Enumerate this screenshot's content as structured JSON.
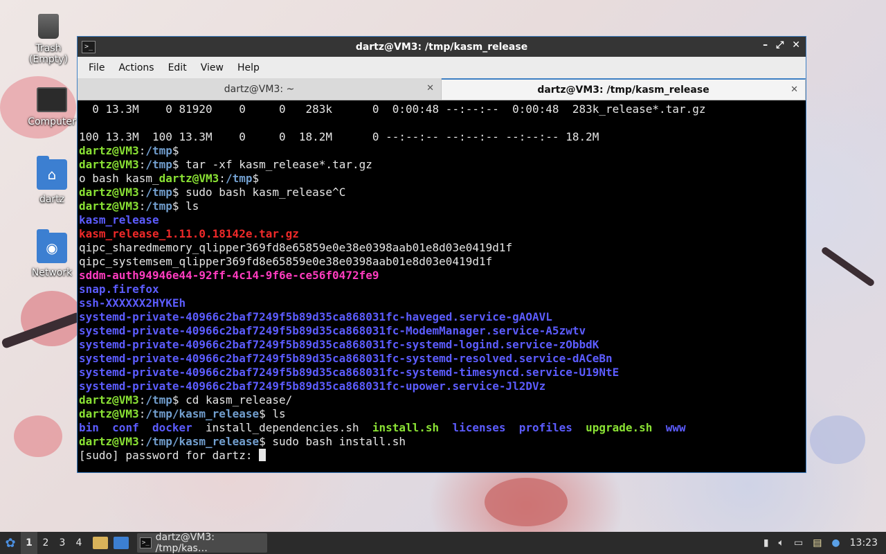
{
  "desktop": {
    "icons": [
      {
        "label": "Trash (Empty)",
        "icon": "trash-icon"
      },
      {
        "label": "Computer",
        "icon": "computer-icon"
      },
      {
        "label": "dartz",
        "icon": "home-folder-icon"
      },
      {
        "label": "Network",
        "icon": "network-icon"
      }
    ]
  },
  "window": {
    "title": "dartz@VM3: /tmp/kasm_release",
    "controls": {
      "minimize": "–",
      "maximize": "⤢",
      "close": "✕"
    },
    "menu": [
      "File",
      "Actions",
      "Edit",
      "View",
      "Help"
    ],
    "tabs": [
      {
        "label": "dartz@VM3: ~",
        "active": false
      },
      {
        "label": "dartz@VM3: /tmp/kasm_release",
        "active": true
      }
    ]
  },
  "terminal": {
    "lines": [
      [
        {
          "t": "  0 13.3M    0 81920    0     0   283k      0  0:00:48 --:--:--  0:00:48  283k_release*.tar.gz",
          "c": ""
        }
      ],
      [
        {
          "t": "",
          "c": ""
        }
      ],
      [
        {
          "t": "100 13.3M  100 13.3M    0     0  18.2M      0 --:--:-- --:--:-- --:--:-- 18.2M",
          "c": ""
        }
      ],
      [
        {
          "t": "dartz@VM3",
          "c": "g"
        },
        {
          "t": ":",
          "c": ""
        },
        {
          "t": "/tmp",
          "c": "b"
        },
        {
          "t": "$",
          "c": ""
        }
      ],
      [
        {
          "t": "dartz@VM3",
          "c": "g"
        },
        {
          "t": ":",
          "c": ""
        },
        {
          "t": "/tmp",
          "c": "b"
        },
        {
          "t": "$ tar -xf kasm_release*.tar.gz",
          "c": ""
        }
      ],
      [
        {
          "t": "o bash kasm_",
          "c": ""
        },
        {
          "t": "dartz@VM3",
          "c": "g"
        },
        {
          "t": ":",
          "c": ""
        },
        {
          "t": "/tmp",
          "c": "b"
        },
        {
          "t": "$",
          "c": ""
        }
      ],
      [
        {
          "t": "dartz@VM3",
          "c": "g"
        },
        {
          "t": ":",
          "c": ""
        },
        {
          "t": "/tmp",
          "c": "b"
        },
        {
          "t": "$ sudo bash kasm_release^C",
          "c": ""
        }
      ],
      [
        {
          "t": "dartz@VM3",
          "c": "g"
        },
        {
          "t": ":",
          "c": ""
        },
        {
          "t": "/tmp",
          "c": "b"
        },
        {
          "t": "$ ls",
          "c": ""
        }
      ],
      [
        {
          "t": "kasm_release",
          "c": "bb"
        }
      ],
      [
        {
          "t": "kasm_release_1.11.0.18142e.tar.gz",
          "c": "r"
        }
      ],
      [
        {
          "t": "qipc_sharedmemory_qlipper369fd8e65859e0e38e0398aab01e8d03e0419d1f",
          "c": ""
        }
      ],
      [
        {
          "t": "qipc_systemsem_qlipper369fd8e65859e0e38e0398aab01e8d03e0419d1f",
          "c": ""
        }
      ],
      [
        {
          "t": "sddm-auth94946e44-92ff-4c14-9f6e-ce56f0472fe9",
          "c": "m"
        }
      ],
      [
        {
          "t": "snap.firefox",
          "c": "bb"
        }
      ],
      [
        {
          "t": "ssh-XXXXXX2HYKEh",
          "c": "bb"
        }
      ],
      [
        {
          "t": "systemd-private-40966c2baf7249f5b89d35ca868031fc-haveged.service-gAOAVL",
          "c": "bb"
        }
      ],
      [
        {
          "t": "systemd-private-40966c2baf7249f5b89d35ca868031fc-ModemManager.service-A5zwtv",
          "c": "bb"
        }
      ],
      [
        {
          "t": "systemd-private-40966c2baf7249f5b89d35ca868031fc-systemd-logind.service-zObbdK",
          "c": "bb"
        }
      ],
      [
        {
          "t": "systemd-private-40966c2baf7249f5b89d35ca868031fc-systemd-resolved.service-dACeBn",
          "c": "bb"
        }
      ],
      [
        {
          "t": "systemd-private-40966c2baf7249f5b89d35ca868031fc-systemd-timesyncd.service-U19NtE",
          "c": "bb"
        }
      ],
      [
        {
          "t": "systemd-private-40966c2baf7249f5b89d35ca868031fc-upower.service-Jl2DVz",
          "c": "bb"
        }
      ],
      [
        {
          "t": "dartz@VM3",
          "c": "g"
        },
        {
          "t": ":",
          "c": ""
        },
        {
          "t": "/tmp",
          "c": "b"
        },
        {
          "t": "$ cd kasm_release/",
          "c": ""
        }
      ],
      [
        {
          "t": "dartz@VM3",
          "c": "g"
        },
        {
          "t": ":",
          "c": ""
        },
        {
          "t": "/tmp/kasm_release",
          "c": "b"
        },
        {
          "t": "$ ls",
          "c": ""
        }
      ],
      [
        {
          "t": "bin",
          "c": "bb"
        },
        {
          "t": "  ",
          "c": ""
        },
        {
          "t": "conf",
          "c": "bb"
        },
        {
          "t": "  ",
          "c": ""
        },
        {
          "t": "docker",
          "c": "bb"
        },
        {
          "t": "  install_dependencies.sh  ",
          "c": ""
        },
        {
          "t": "install.sh",
          "c": "g"
        },
        {
          "t": "  ",
          "c": ""
        },
        {
          "t": "licenses",
          "c": "bb"
        },
        {
          "t": "  ",
          "c": ""
        },
        {
          "t": "profiles",
          "c": "bb"
        },
        {
          "t": "  ",
          "c": ""
        },
        {
          "t": "upgrade.sh",
          "c": "g"
        },
        {
          "t": "  ",
          "c": ""
        },
        {
          "t": "www",
          "c": "bb"
        }
      ],
      [
        {
          "t": "dartz@VM3",
          "c": "g"
        },
        {
          "t": ":",
          "c": ""
        },
        {
          "t": "/tmp/kasm_release",
          "c": "b"
        },
        {
          "t": "$ sudo bash install.sh",
          "c": ""
        }
      ],
      [
        {
          "t": "[sudo] password for dartz: ",
          "c": ""
        }
      ]
    ]
  },
  "taskbar": {
    "workspaces": [
      "1",
      "2",
      "3",
      "4"
    ],
    "active_workspace": "1",
    "task_label": "dartz@VM3: /tmp/kas…",
    "clock": "13:23"
  }
}
